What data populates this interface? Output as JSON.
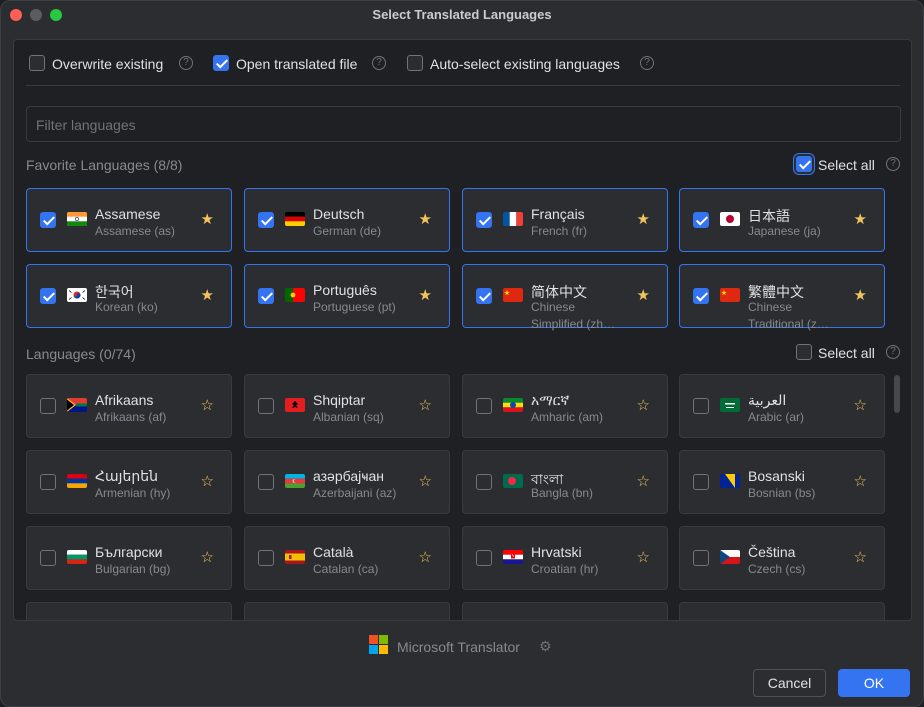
{
  "window": {
    "title": "Select Translated Languages"
  },
  "options": [
    {
      "label": "Overwrite existing",
      "checked": false
    },
    {
      "label": "Open translated file",
      "checked": true
    },
    {
      "label": "Auto-select existing languages",
      "checked": false
    }
  ],
  "filter": {
    "placeholder": "Filter languages"
  },
  "favorites": {
    "title": "Favorite Languages (8/8)",
    "select_all_label": "Select all",
    "select_all_checked": true,
    "items": [
      {
        "name": "Assamese",
        "sub": "Assamese (as)",
        "flag": "india-flag",
        "checked": true,
        "starred": true
      },
      {
        "name": "Deutsch",
        "sub": "German (de)",
        "flag": "germany-flag",
        "checked": true,
        "starred": true
      },
      {
        "name": "Français",
        "sub": "French (fr)",
        "flag": "france-flag",
        "checked": true,
        "starred": true
      },
      {
        "name": "日本語",
        "sub": "Japanese (ja)",
        "flag": "japan-flag",
        "checked": true,
        "starred": true
      },
      {
        "name": "한국어",
        "sub": "Korean (ko)",
        "flag": "south-korea-flag",
        "checked": true,
        "starred": true
      },
      {
        "name": "Português",
        "sub": "Portuguese (pt)",
        "flag": "portugal-flag",
        "checked": true,
        "starred": true
      },
      {
        "name": "简体中文",
        "sub": "Chinese Simplified (zh…",
        "flag": "china-flag",
        "checked": true,
        "starred": true
      },
      {
        "name": "繁體中文",
        "sub": "Chinese Traditional (z…",
        "flag": "china-flag",
        "checked": true,
        "starred": true
      }
    ]
  },
  "languages": {
    "title": "Languages (0/74)",
    "select_all_label": "Select all",
    "select_all_checked": false,
    "items": [
      {
        "name": "Afrikaans",
        "sub": "Afrikaans (af)",
        "flag": "south-africa-flag",
        "checked": false,
        "starred": false
      },
      {
        "name": "Shqiptar",
        "sub": "Albanian (sq)",
        "flag": "albania-flag",
        "checked": false,
        "starred": false
      },
      {
        "name": "አማርኛ",
        "sub": "Amharic (am)",
        "flag": "ethiopia-flag",
        "checked": false,
        "starred": false
      },
      {
        "name": "العربية",
        "sub": "Arabic (ar)",
        "flag": "saudi-arabia-flag",
        "checked": false,
        "starred": false
      },
      {
        "name": "Հայերեն",
        "sub": "Armenian (hy)",
        "flag": "armenia-flag",
        "checked": false,
        "starred": false
      },
      {
        "name": "азәрбајҹан",
        "sub": "Azerbaijani (az)",
        "flag": "azerbaijan-flag",
        "checked": false,
        "starred": false
      },
      {
        "name": "বাংলা",
        "sub": "Bangla (bn)",
        "flag": "bangladesh-flag",
        "checked": false,
        "starred": false
      },
      {
        "name": "Bosanski",
        "sub": "Bosnian (bs)",
        "flag": "bosnia-flag",
        "checked": false,
        "starred": false
      },
      {
        "name": "Български",
        "sub": "Bulgarian (bg)",
        "flag": "bulgaria-flag",
        "checked": false,
        "starred": false
      },
      {
        "name": "Català",
        "sub": "Catalan (ca)",
        "flag": "spain-flag",
        "checked": false,
        "starred": false
      },
      {
        "name": "Hrvatski",
        "sub": "Croatian (hr)",
        "flag": "croatia-flag",
        "checked": false,
        "starred": false
      },
      {
        "name": "Čeština",
        "sub": "Czech (cs)",
        "flag": "czech-flag",
        "checked": false,
        "starred": false
      }
    ]
  },
  "footer": {
    "provider_label": "Microsoft Translator",
    "provider_icon": "microsoft-logo-icon",
    "cancel_label": "Cancel",
    "ok_label": "OK"
  },
  "colors": {
    "accent": "#3574f0",
    "star": "#f2c55c",
    "background": "#2b2d30"
  }
}
